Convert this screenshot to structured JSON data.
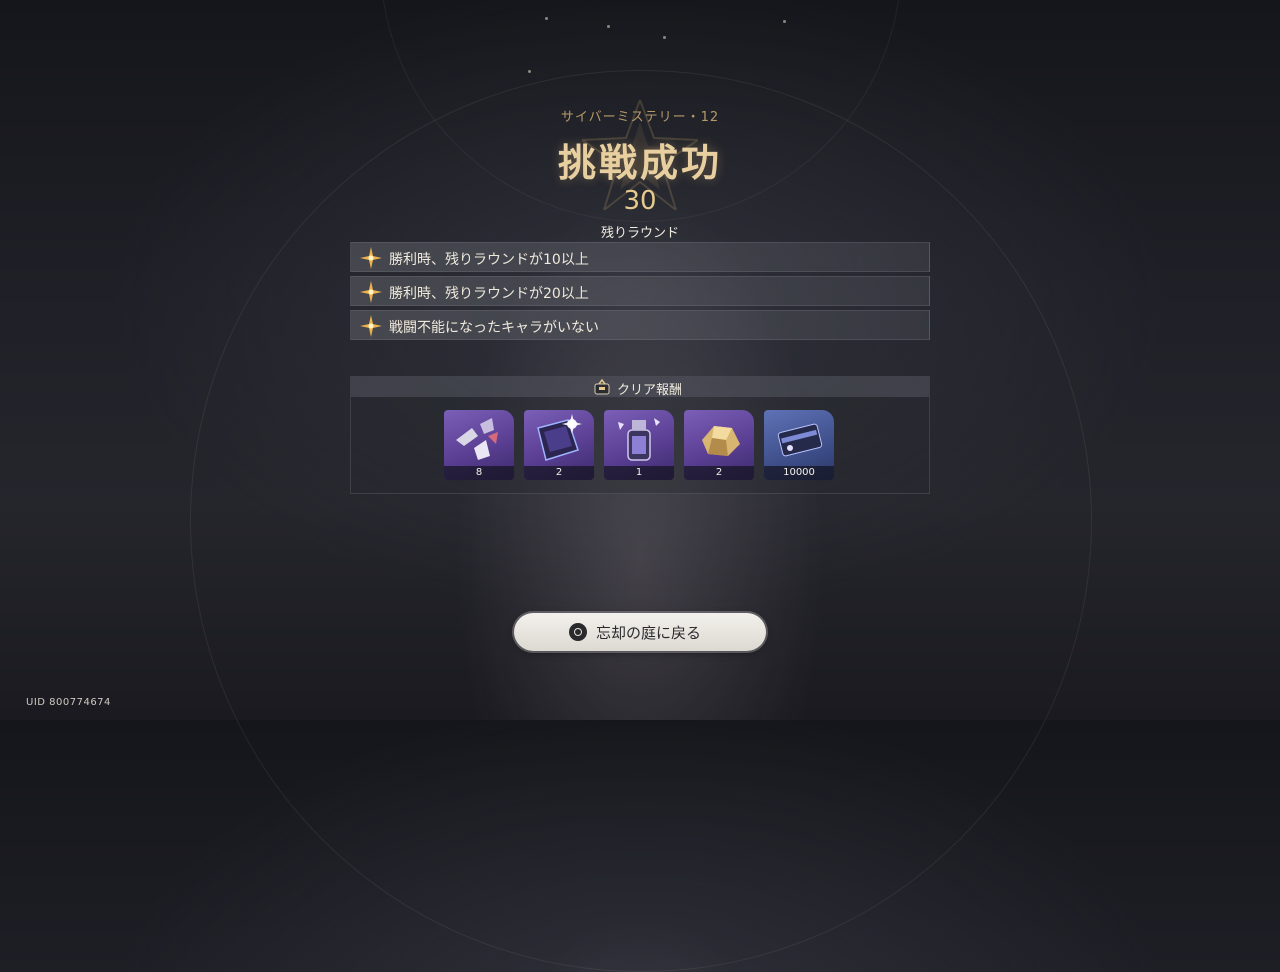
{
  "header": {
    "subtitle": "サイバーミステリー・12",
    "title": "挑戦成功",
    "rounds_value": "30",
    "rounds_label": "残りラウンド"
  },
  "conditions": [
    {
      "text": "勝利時、残りラウンドが10以上",
      "icon": "sparkle-star-icon"
    },
    {
      "text": "勝利時、残りラウンドが20以上",
      "icon": "sparkle-star-icon"
    },
    {
      "text": "戦闘不能になったキャラがいない",
      "icon": "sparkle-star-icon"
    }
  ],
  "rewards": {
    "title": "クリア報酬",
    "icon": "reward-chest-icon",
    "items": [
      {
        "icon": "crystal-shards-icon",
        "count": "8",
        "rarity": "purple"
      },
      {
        "icon": "glowing-book-icon",
        "count": "2",
        "rarity": "purple"
      },
      {
        "icon": "potion-vial-icon",
        "count": "1",
        "rarity": "purple"
      },
      {
        "icon": "gold-ore-icon",
        "count": "2",
        "rarity": "purple"
      },
      {
        "icon": "credit-card-icon",
        "count": "10000",
        "rarity": "blue"
      }
    ]
  },
  "return_button": {
    "label": "忘却の庭に戻る",
    "icon": "circle-button-icon"
  },
  "footer": {
    "uid": "UID 800774674"
  },
  "colors": {
    "title_gold": "#e8cfa0",
    "subtitle_gold": "#b69a6a",
    "purple_card": "#5a3f93",
    "blue_card": "#41528e"
  }
}
